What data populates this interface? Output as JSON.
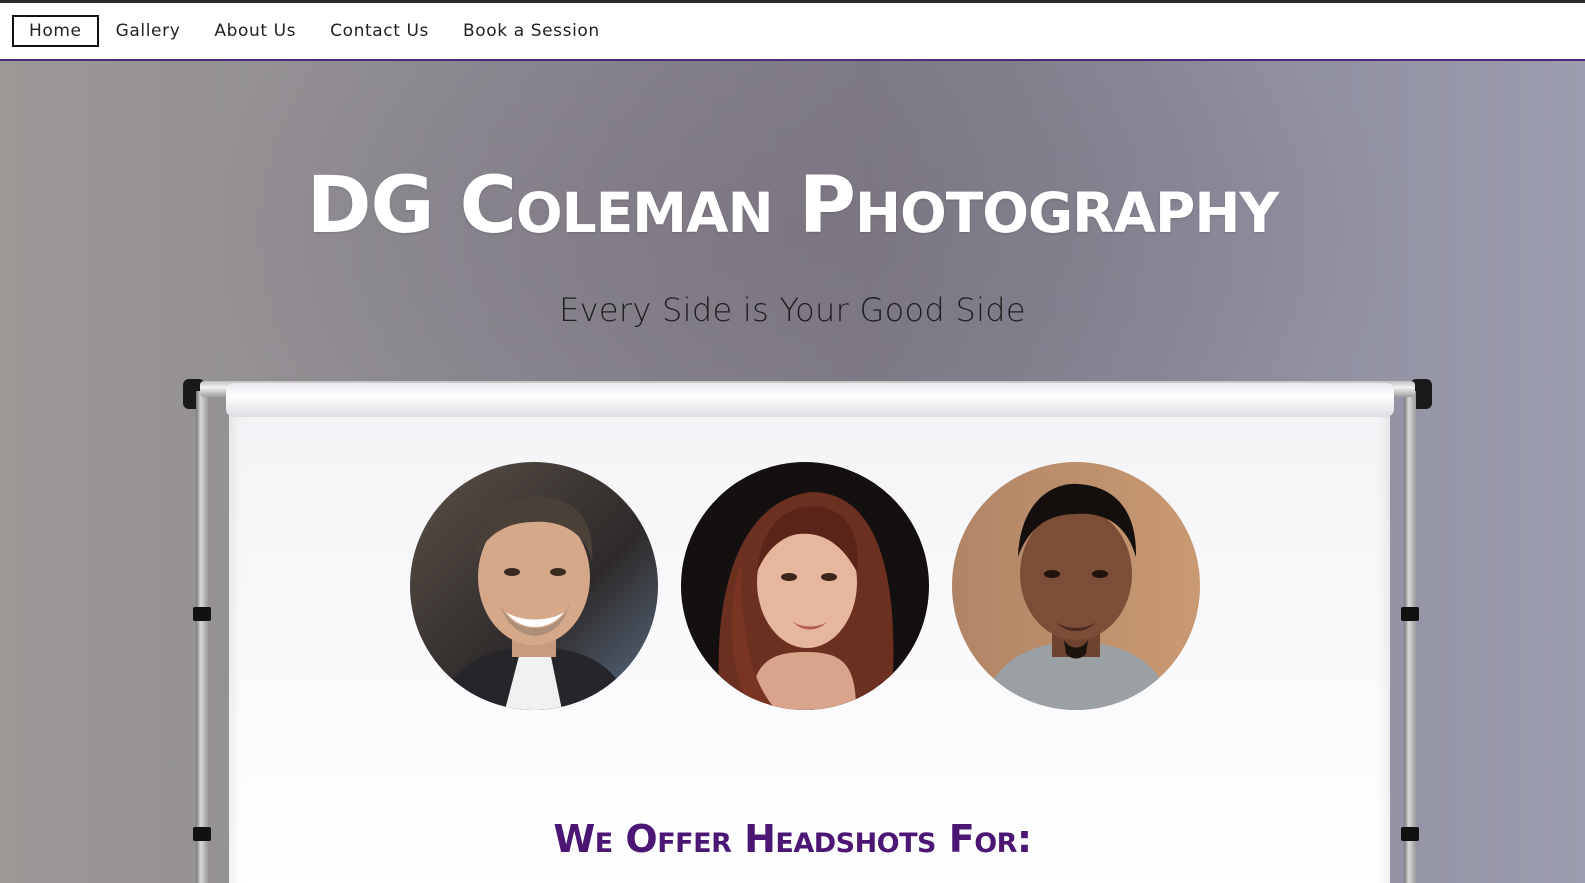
{
  "nav": {
    "items": [
      {
        "label": "Home",
        "active": true
      },
      {
        "label": "Gallery",
        "active": false
      },
      {
        "label": "About Us",
        "active": false
      },
      {
        "label": "Contact Us",
        "active": false
      },
      {
        "label": "Book a Session",
        "active": false
      }
    ]
  },
  "hero": {
    "title": "DG Coleman Photography",
    "tagline": "Every Side is Your Good Side"
  },
  "headshots": [
    {
      "icon": "headshot-man-smiling-photo"
    },
    {
      "icon": "headshot-woman-auburn-hair-photo"
    },
    {
      "icon": "headshot-man-beard-photo"
    }
  ],
  "offer": {
    "heading": "We Offer Headshots For:"
  },
  "colors": {
    "accent": "#4b1674",
    "nav_border": "#4b2a7a",
    "title": "#ffffff"
  }
}
